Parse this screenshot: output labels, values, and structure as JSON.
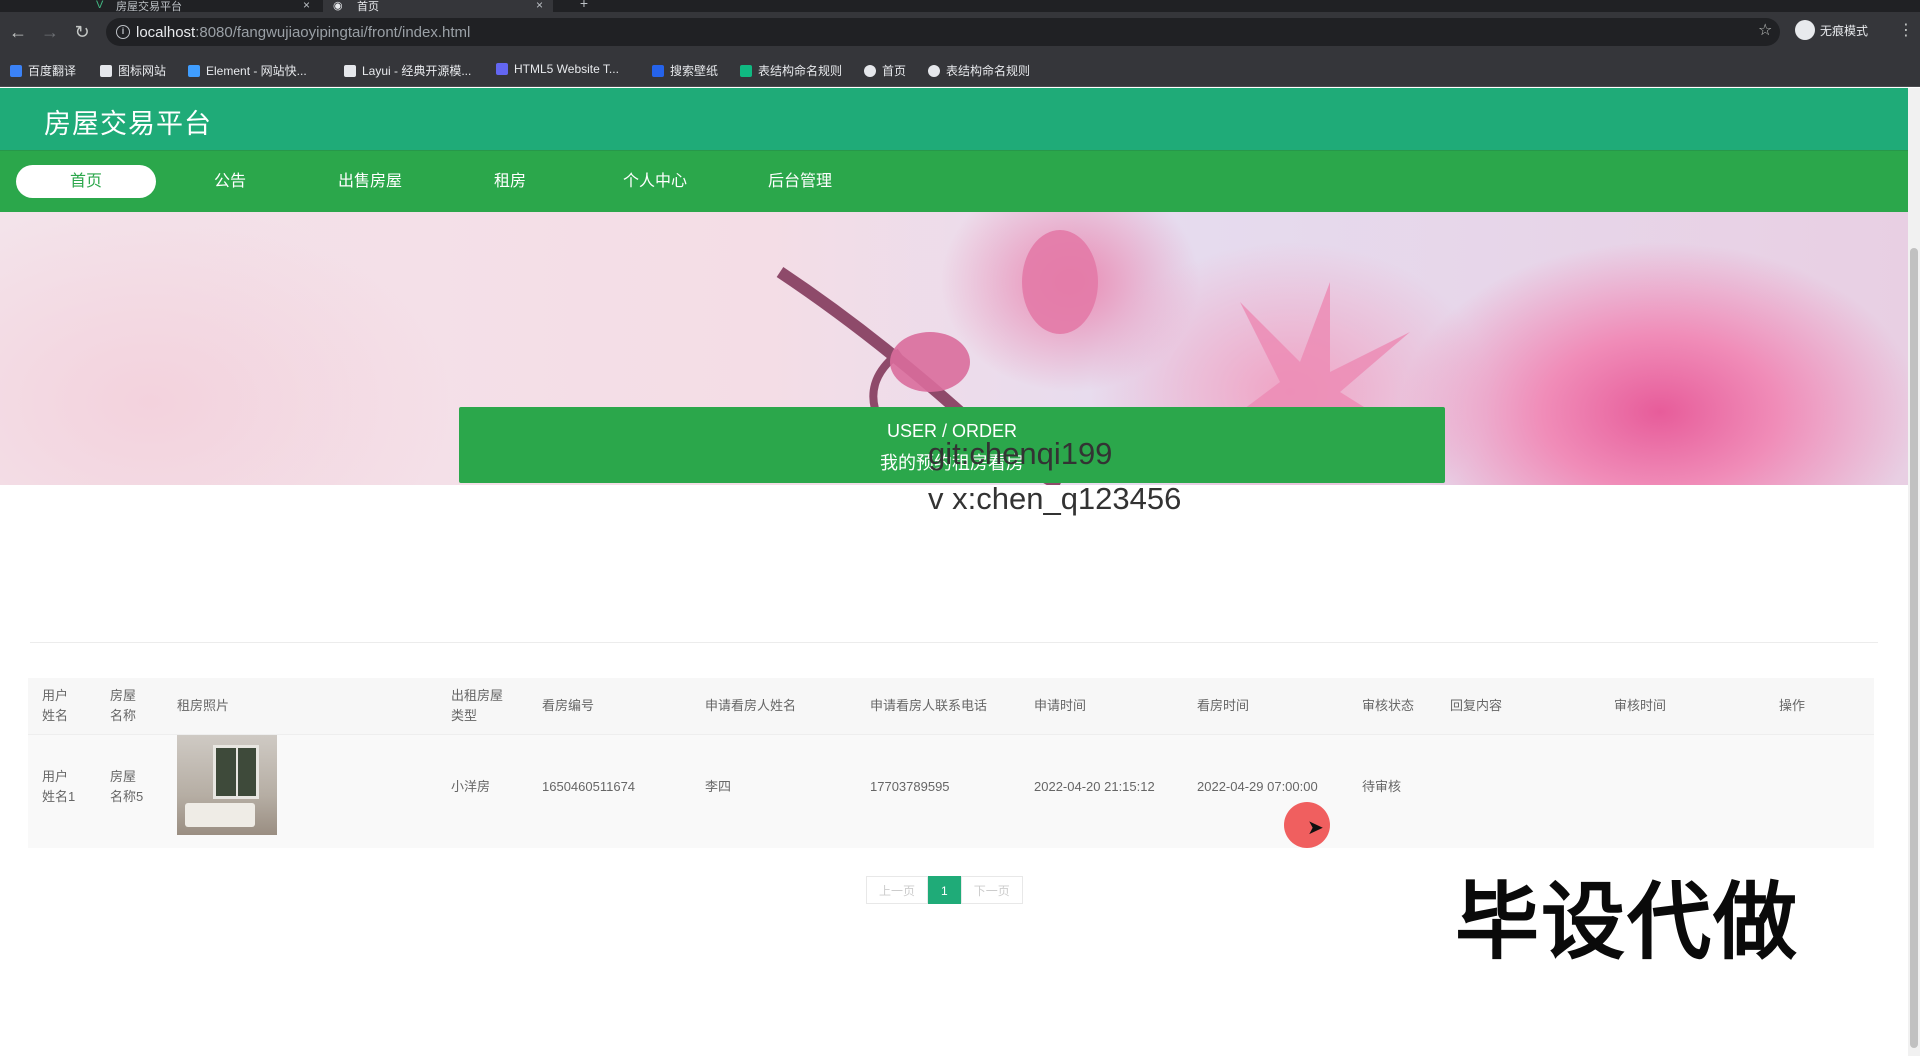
{
  "browser": {
    "tabs": [
      {
        "title": "房屋交易平台"
      },
      {
        "title": "首页"
      }
    ],
    "url_host": "localhost",
    "url_path": ":8080/fangwujiaoyipingtai/front/index.html",
    "incognito_label": "无痕模式",
    "bookmarks": [
      {
        "label": "百度翻译",
        "color": "#3b82f6"
      },
      {
        "label": "图标网站",
        "color": "#e5e7eb"
      },
      {
        "label": "Element - 网站快...",
        "color": "#409eff"
      },
      {
        "label": "Layui - 经典开源模...",
        "color": "#e5e7eb"
      },
      {
        "label": "HTML5 Website T...",
        "color": "#6366f1"
      },
      {
        "label": "搜索壁纸",
        "color": "#2563eb"
      },
      {
        "label": "表结构命名规则",
        "color": "#10b981"
      },
      {
        "label": "首页",
        "color": "#e5e7eb"
      },
      {
        "label": "表结构命名规则",
        "color": "#e5e7eb"
      }
    ]
  },
  "site": {
    "logo": "房屋交易平台",
    "nav": [
      "首页",
      "公告",
      "出售房屋",
      "租房",
      "个人中心",
      "后台管理"
    ],
    "active_nav": "首页",
    "brand_green": "#2ba74b",
    "header_green": "#1fab78"
  },
  "banner": {
    "slide_count": 3,
    "active_slide": 1
  },
  "section": {
    "title_en": "USER / ORDER",
    "title_cn": "我的预约租房看房"
  },
  "watermark": {
    "line1": "git:chenqi199",
    "line2": "v x:chen_q123456"
  },
  "table": {
    "headers": [
      "用户姓名",
      "房屋名称",
      "租房照片",
      "出租房屋类型",
      "看房编号",
      "申请看房人姓名",
      "申请看房人联系电话",
      "申请时间",
      "看房时间",
      "审核状态",
      "回复内容",
      "审核时间",
      "操作"
    ],
    "rows": [
      {
        "user_name": "用户姓名1",
        "house_name": "房屋名称5",
        "house_type": "小洋房",
        "view_no": "1650460511674",
        "applicant_name": "李四",
        "applicant_phone": "17703789595",
        "apply_time": "2022-04-20 21:15:12",
        "view_time": "2022-04-29 07:00:00",
        "status": "待审核",
        "reply": "",
        "review_time": "",
        "action": ""
      }
    ]
  },
  "pagination": {
    "prev": "上一页",
    "current": "1",
    "next": "下一页"
  },
  "overlay_text": "毕设代做"
}
